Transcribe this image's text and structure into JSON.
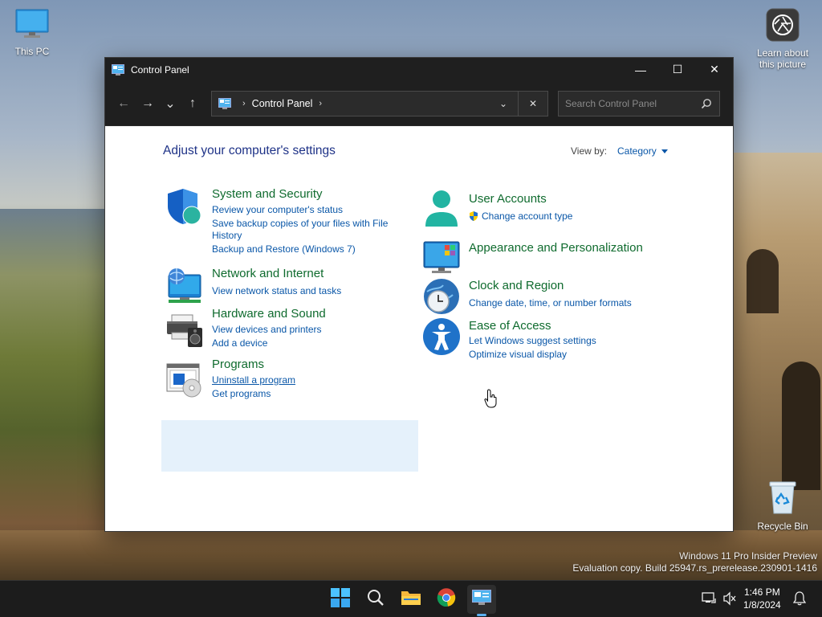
{
  "desktop": {
    "this_pc_label": "This PC",
    "learn_label_1": "Learn about",
    "learn_label_2": "this picture",
    "recycle_label": "Recycle Bin",
    "watermark_line1": "Windows 11 Pro Insider Preview",
    "watermark_line2": "Evaluation copy. Build 25947.rs_prerelease.230901-1416"
  },
  "window": {
    "title": "Control Panel",
    "minimize": "—",
    "maximize": "☐",
    "close": "✕"
  },
  "nav": {
    "back": "←",
    "forward": "→",
    "recent": "⌄",
    "up": "↑",
    "address_sep": "›",
    "address_crumb": "Control Panel",
    "address_trailing_sep": "›",
    "dropdown": "⌄",
    "clear": "✕",
    "search_placeholder": "Search Control Panel"
  },
  "content": {
    "heading": "Adjust your computer's settings",
    "view_by_label": "View by:",
    "view_by_value": "Category",
    "categories": [
      {
        "title": "System and Security",
        "links": [
          "Review your computer's status",
          "Save backup copies of your files with File",
          "History",
          "Backup and Restore (Windows 7)"
        ]
      },
      {
        "title": "Network and Internet",
        "links": [
          "View network status and tasks"
        ]
      },
      {
        "title": "Hardware and Sound",
        "links": [
          "View devices and printers",
          "Add a device"
        ]
      },
      {
        "title": "Programs",
        "links": [
          "Uninstall a program",
          "Get programs"
        ]
      },
      {
        "title": "User Accounts",
        "links": [
          "Change account type"
        ]
      },
      {
        "title": "Appearance and Personalization",
        "links": []
      },
      {
        "title": "Clock and Region",
        "links": [
          "Change date, time, or number formats"
        ]
      },
      {
        "title": "Ease of Access",
        "links": [
          "Let Windows suggest settings",
          "Optimize visual display"
        ]
      }
    ]
  },
  "taskbar": {
    "time": "1:46 PM",
    "date": "1/8/2024"
  },
  "colors": {
    "category_title": "#0f6b2e",
    "link": "#0a57a8",
    "heading": "#1e3287",
    "highlight": "#e5f1fb",
    "titlebar": "#1f1f1f"
  }
}
